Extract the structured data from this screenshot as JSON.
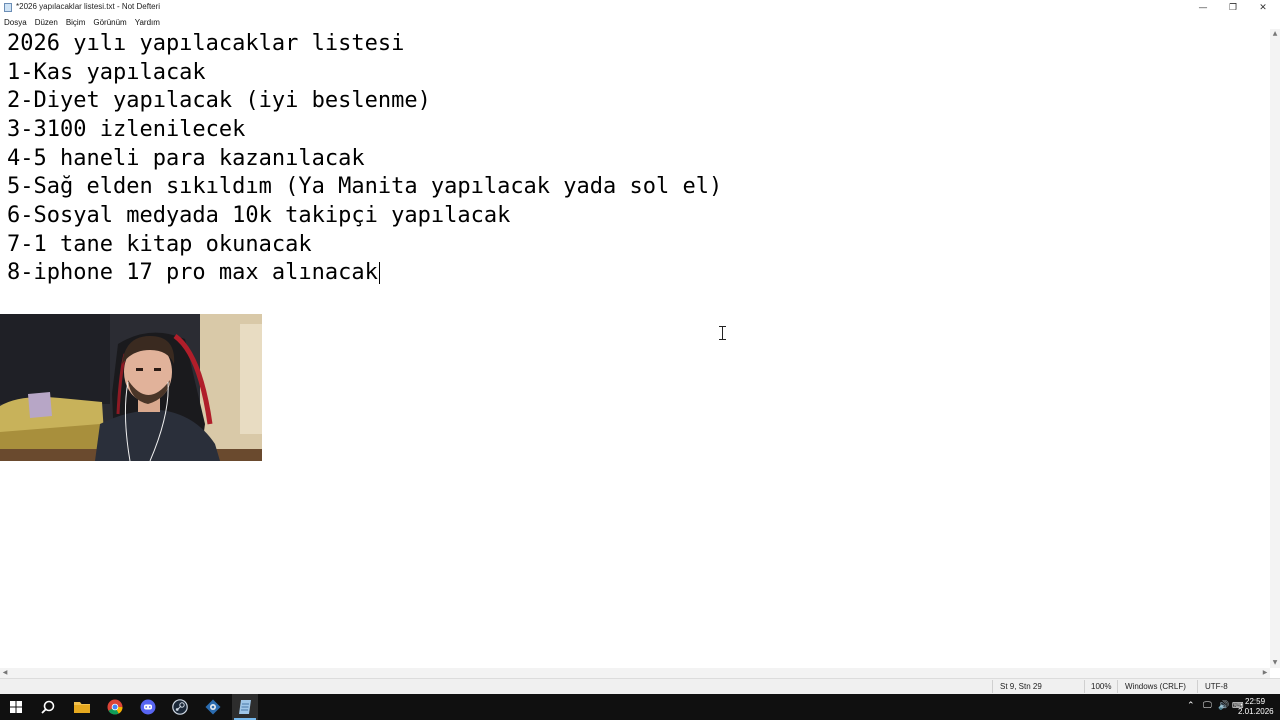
{
  "window": {
    "title": "*2026 yapılacaklar listesi.txt - Not Defteri",
    "minimize_glyph": "—",
    "restore_glyph": "❐",
    "close_glyph": "✕"
  },
  "menu": {
    "items": [
      "Dosya",
      "Düzen",
      "Biçim",
      "Görünüm",
      "Yardım"
    ]
  },
  "editor": {
    "lines": [
      "2026 yılı yapılacaklar listesi",
      "1-Kas yapılacak",
      "2-Diyet yapılacak (iyi beslenme)",
      "3-3100 izlenilecek",
      "4-5 haneli para kazanılacak",
      "5-Sağ elden sıkıldım (Ya Manita yapılacak yada sol el)",
      "6-Sosyal medyada 10k takipçi yapılacak",
      "7-1 tane kitap okunacak",
      "8-iphone 17 pro max alınacak"
    ]
  },
  "statusbar": {
    "position": "St 9, Stn 29",
    "zoom": "100%",
    "line_ending": "Windows (CRLF)",
    "encoding": "UTF-8"
  },
  "taskbar": {
    "time": "22:59",
    "date": "2.01.2026",
    "apps": [
      "windows-start",
      "search",
      "file-explorer",
      "chrome",
      "discord",
      "steam",
      "app-settings",
      "notepad"
    ]
  }
}
